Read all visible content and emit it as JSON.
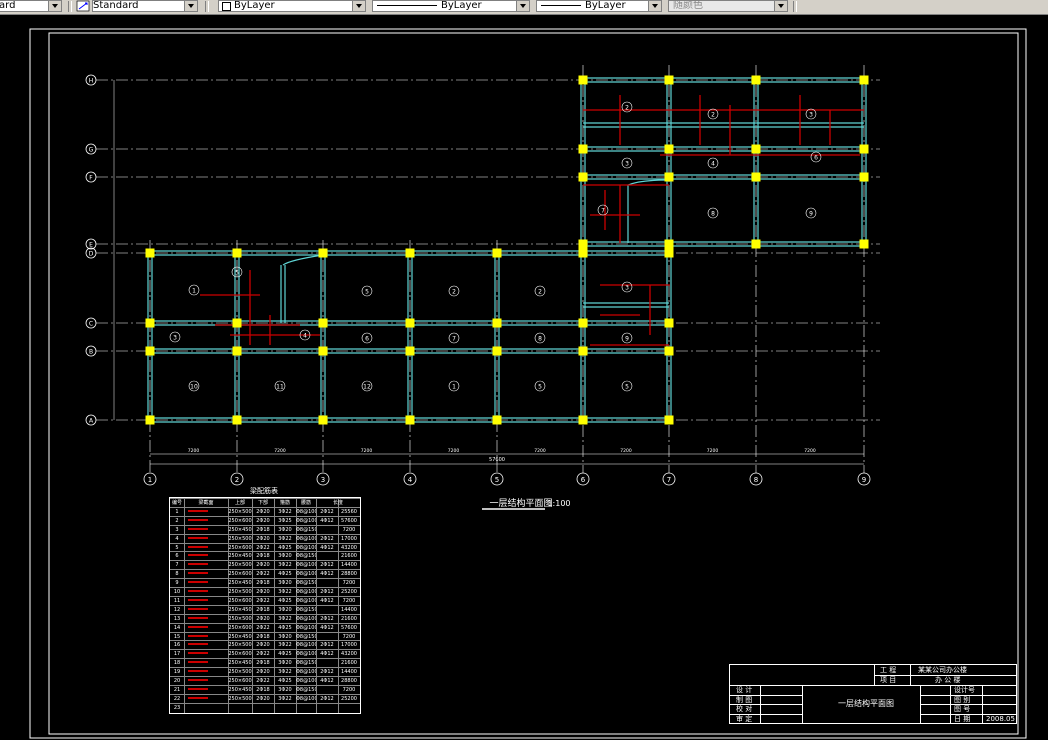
{
  "toolbar": {
    "text_style": "ard",
    "dim_style": "Standard",
    "layer": "ByLayer",
    "linetype": "ByLayer",
    "lineweight": "ByLayer",
    "color": "随颜色"
  },
  "drawing": {
    "grid_rows": [
      "H",
      "G",
      "F",
      "E",
      "D",
      "C",
      "B",
      "A"
    ],
    "grid_cols": [
      "1",
      "2",
      "3",
      "4",
      "5",
      "6",
      "7",
      "8",
      "9"
    ],
    "dims_bottom": [
      "7200",
      "7200",
      "7200",
      "7200",
      "7200",
      "7200",
      "7200",
      "7200"
    ],
    "dim_total": "57600",
    "plan_title": "一层结构平面图",
    "plan_scale": "1:100",
    "schedule_title": "梁配筋表",
    "schedule_headers": [
      "编号",
      "梁截面",
      "上部",
      "下部",
      "箍筋",
      "腰筋",
      "长度"
    ],
    "schedule_rows": [
      [
        "1",
        "250×500",
        "2Φ20",
        "3Φ22",
        "Φ8@100",
        "2Φ12",
        "25560"
      ],
      [
        "2",
        "250×600",
        "2Φ20",
        "3Φ25",
        "Φ8@100",
        "4Φ12",
        "57600"
      ],
      [
        "3",
        "250×450",
        "2Φ18",
        "3Φ20",
        "Φ8@150",
        "",
        "7200"
      ],
      [
        "4",
        "250×500",
        "2Φ20",
        "3Φ22",
        "Φ8@100",
        "2Φ12",
        "17000"
      ],
      [
        "5",
        "250×600",
        "2Φ22",
        "4Φ25",
        "Φ8@100",
        "4Φ12",
        "43200"
      ],
      [
        "6",
        "250×450",
        "2Φ18",
        "3Φ20",
        "Φ8@150",
        "",
        "21600"
      ],
      [
        "7",
        "250×500",
        "2Φ20",
        "3Φ22",
        "Φ8@100",
        "2Φ12",
        "14400"
      ],
      [
        "8",
        "250×600",
        "2Φ22",
        "4Φ25",
        "Φ8@100",
        "4Φ12",
        "28800"
      ],
      [
        "9",
        "250×450",
        "2Φ18",
        "3Φ20",
        "Φ8@150",
        "",
        "7200"
      ],
      [
        "10",
        "250×500",
        "2Φ20",
        "3Φ22",
        "Φ8@100",
        "2Φ12",
        "25200"
      ],
      [
        "11",
        "250×600",
        "2Φ22",
        "4Φ25",
        "Φ8@100",
        "4Φ12",
        "7200"
      ],
      [
        "12",
        "250×450",
        "2Φ18",
        "3Φ20",
        "Φ8@150",
        "",
        "14400"
      ],
      [
        "13",
        "250×500",
        "2Φ20",
        "3Φ22",
        "Φ8@100",
        "2Φ12",
        "21600"
      ],
      [
        "14",
        "250×600",
        "2Φ22",
        "4Φ25",
        "Φ8@100",
        "4Φ12",
        "57600"
      ],
      [
        "15",
        "250×450",
        "2Φ18",
        "3Φ20",
        "Φ8@150",
        "",
        "7200"
      ],
      [
        "16",
        "250×500",
        "2Φ20",
        "3Φ22",
        "Φ8@100",
        "2Φ12",
        "17000"
      ],
      [
        "17",
        "250×600",
        "2Φ22",
        "4Φ25",
        "Φ8@100",
        "4Φ12",
        "43200"
      ],
      [
        "18",
        "250×450",
        "2Φ18",
        "3Φ20",
        "Φ8@150",
        "",
        "21600"
      ],
      [
        "19",
        "250×500",
        "2Φ20",
        "3Φ22",
        "Φ8@100",
        "2Φ12",
        "14400"
      ],
      [
        "20",
        "250×600",
        "2Φ22",
        "4Φ25",
        "Φ8@100",
        "4Φ12",
        "28800"
      ],
      [
        "21",
        "250×450",
        "2Φ18",
        "3Φ20",
        "Φ8@150",
        "",
        "7200"
      ],
      [
        "22",
        "250×500",
        "2Φ20",
        "3Φ22",
        "Φ8@100",
        "2Φ12",
        "25200"
      ],
      [
        "23",
        "",
        "",
        "",
        "",
        "",
        ""
      ]
    ],
    "room_labels": [
      "1",
      "5",
      "5",
      "2",
      "2",
      "3",
      "3",
      "4",
      "6",
      "7",
      "8",
      "9",
      "10",
      "11",
      "12"
    ]
  },
  "titleblock": {
    "project_label": "工 程",
    "project_value": "某某公司办公楼",
    "item_label": "项 目",
    "item_value": "办 公 楼",
    "drawing_name": "一层结构平面图",
    "rows_left": [
      "设 计",
      "制 图",
      "校 对",
      "审 定"
    ],
    "rows_right_labels": [
      "设计号",
      "图 别",
      "图 号",
      "日 期"
    ],
    "rows_right_values": [
      "",
      "",
      "",
      "2008.05"
    ]
  },
  "colors": {
    "beam": "#5fd4d4",
    "column": "#ffff00",
    "rebar": "#cc0000",
    "axis": "#ffffff",
    "background": "#000000"
  }
}
